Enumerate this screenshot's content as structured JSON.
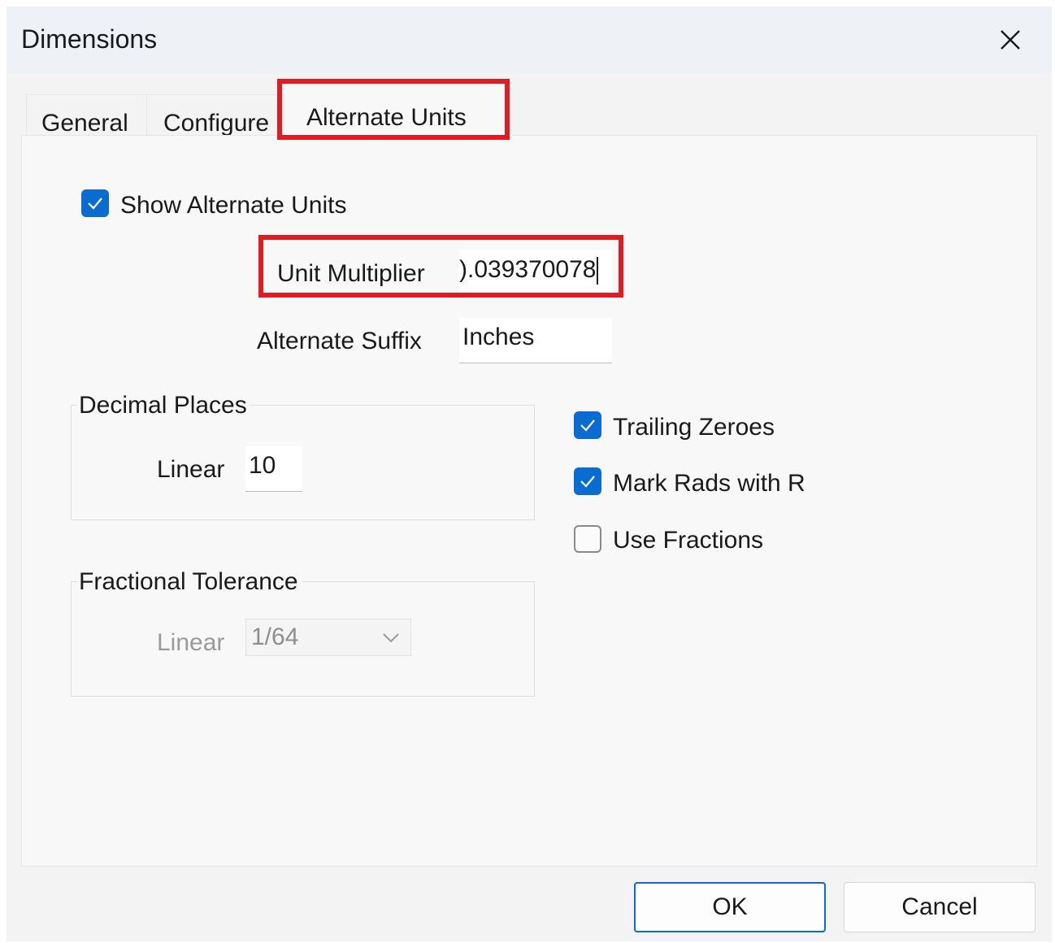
{
  "window": {
    "title": "Dimensions"
  },
  "tabs": [
    {
      "label": "General"
    },
    {
      "label": "Configure"
    },
    {
      "label": "Alternate Units",
      "selected": true
    }
  ],
  "show_alternate_units": {
    "label": "Show Alternate Units",
    "checked": true
  },
  "unit_multiplier": {
    "label": "Unit Multiplier",
    "value": ").039370078"
  },
  "alternate_suffix": {
    "label": "Alternate Suffix",
    "value": "Inches"
  },
  "decimal_places": {
    "title": "Decimal Places",
    "linear_label": "Linear",
    "linear_value": "10"
  },
  "options": {
    "trailing_zeroes": {
      "label": "Trailing Zeroes",
      "checked": true
    },
    "mark_rads": {
      "label": "Mark Rads with R",
      "checked": true
    },
    "use_fractions": {
      "label": "Use Fractions",
      "checked": false
    }
  },
  "fractional_tolerance": {
    "title": "Fractional Tolerance",
    "linear_label": "Linear",
    "linear_value": "1/64",
    "enabled": false
  },
  "buttons": {
    "ok": "OK",
    "cancel": "Cancel"
  },
  "colors": {
    "accent": "#0a6cd1",
    "highlight": "#e11b22"
  }
}
